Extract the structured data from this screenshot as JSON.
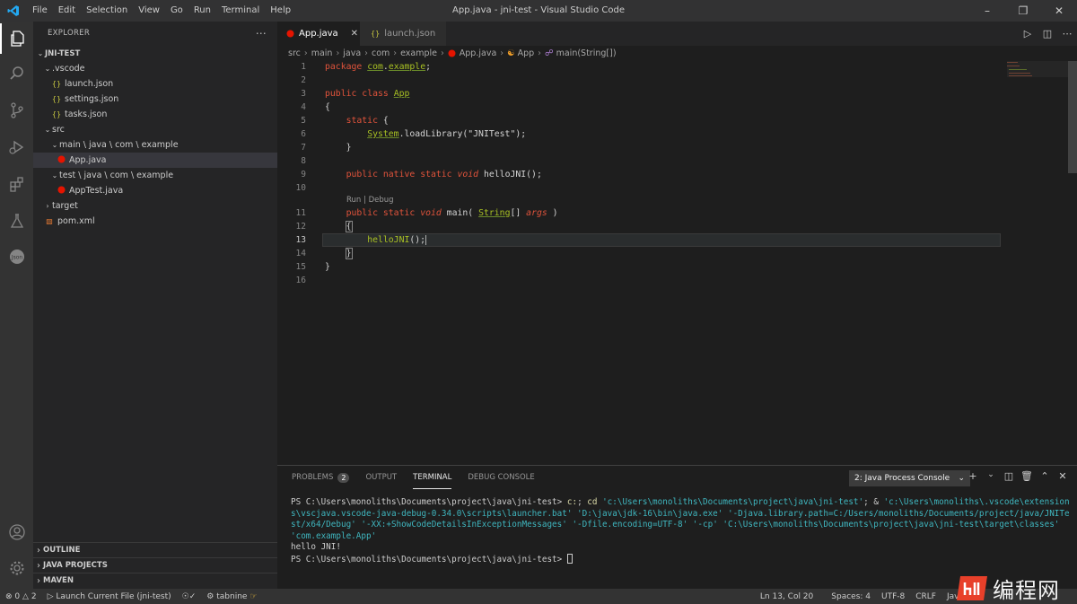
{
  "window": {
    "title": "App.java - jni-test - Visual Studio Code"
  },
  "menu": [
    "File",
    "Edit",
    "Selection",
    "View",
    "Go",
    "Run",
    "Terminal",
    "Help"
  ],
  "explorer": {
    "header": "EXPLORER",
    "project": "JNI-TEST",
    "tree": [
      {
        "label": ".vscode",
        "type": "folder",
        "open": true
      },
      {
        "label": "launch.json",
        "type": "json"
      },
      {
        "label": "settings.json",
        "type": "json"
      },
      {
        "label": "tasks.json",
        "type": "json"
      },
      {
        "label": "src",
        "type": "folder",
        "open": true
      },
      {
        "label": "main \\ java \\ com \\ example",
        "type": "folder",
        "open": true
      },
      {
        "label": "App.java",
        "type": "java-error",
        "selected": true
      },
      {
        "label": "test \\ java \\ com \\ example",
        "type": "folder",
        "open": true
      },
      {
        "label": "AppTest.java",
        "type": "java-error"
      },
      {
        "label": "target",
        "type": "folder",
        "open": false
      },
      {
        "label": "pom.xml",
        "type": "xml"
      }
    ],
    "sections": [
      "OUTLINE",
      "JAVA PROJECTS",
      "MAVEN"
    ]
  },
  "tabs": [
    {
      "label": "App.java",
      "active": true
    },
    {
      "label": "launch.json",
      "active": false
    }
  ],
  "breadcrumb": [
    "src",
    "main",
    "java",
    "com",
    "example",
    "App.java",
    "App",
    "main(String[])"
  ],
  "code": {
    "line_numbers": [
      "1",
      "2",
      "3",
      "4",
      "5",
      "6",
      "7",
      "8",
      "9",
      "10",
      "11",
      "12",
      "13",
      "14",
      "15",
      "16"
    ],
    "current_line": "13",
    "codelens": "Run | Debug"
  },
  "panel": {
    "tabs": [
      "PROBLEMS",
      "OUTPUT",
      "TERMINAL",
      "DEBUG CONSOLE"
    ],
    "problems_count": "2",
    "active_tab": "TERMINAL",
    "console_select": "2: Java Process Console",
    "terminal": {
      "prompt1": "PS C:\\Users\\monoliths\\Documents\\project\\java\\jni-test> ",
      "cmd_a": "c:",
      "cmd_b": "; ",
      "cmd_c": "cd",
      "str1": " 'c:\\Users\\monoliths\\Documents\\project\\java\\jni-test'",
      "amp": "; & ",
      "str2": "'c:\\Users\\monoliths\\.vscode\\extensions\\vscjava.vscode-java-debug-0.34.0\\scripts\\launcher.bat'",
      "str3": " 'D:\\java\\jdk-16\\bin\\java.exe'",
      "str4": " '-Djava.library.path=C:/Users/monoliths/Documents/project/java/JNITest/x64/Debug'",
      "str5": " '-XX:+ShowCodeDetailsInExceptionMessages'",
      "str6": " '-Dfile.encoding=UTF-8'",
      "str7": " '-cp'",
      "str8": " 'C:\\Users\\monoliths\\Documents\\project\\java\\jni-test\\target\\classes'",
      "str9": " 'com.example.App'",
      "output": "hello JNI!",
      "prompt2": "PS C:\\Users\\monoliths\\Documents\\project\\java\\jni-test> "
    }
  },
  "status": {
    "errors": "0",
    "warnings": "2",
    "launch": "Launch Current File (jni-test)",
    "tabnine": "tabnine",
    "position": "Ln 13, Col 20",
    "spaces": "Spaces: 4",
    "encoding": "UTF-8",
    "eol": "CRLF",
    "language": "Java"
  },
  "watermark": "编程网",
  "colors": {
    "accent": "#007acc",
    "error": "#e51400",
    "keyword": "#e0533b",
    "type": "#a8c023"
  }
}
